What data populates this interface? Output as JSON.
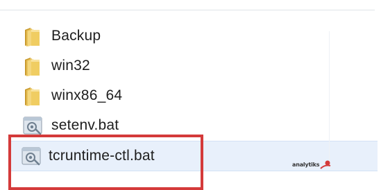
{
  "file_list": {
    "items": [
      {
        "name": "Backup",
        "type": "folder",
        "icon": "folder-icon"
      },
      {
        "name": "win32",
        "type": "folder",
        "icon": "folder-icon"
      },
      {
        "name": "winx86_64",
        "type": "folder",
        "icon": "folder-icon"
      },
      {
        "name": "setenv.bat",
        "type": "batch-file",
        "icon": "batch-file-icon"
      },
      {
        "name": "tcruntime-ctl.bat",
        "type": "batch-file",
        "icon": "batch-file-icon",
        "selected": true
      }
    ]
  },
  "annotation": {
    "highlight_color": "#d43a3a"
  },
  "watermark": {
    "brand": "analytiks"
  },
  "colors": {
    "selection_bg": "#e8f0fb",
    "folder_yellow": "#e8c25a"
  }
}
